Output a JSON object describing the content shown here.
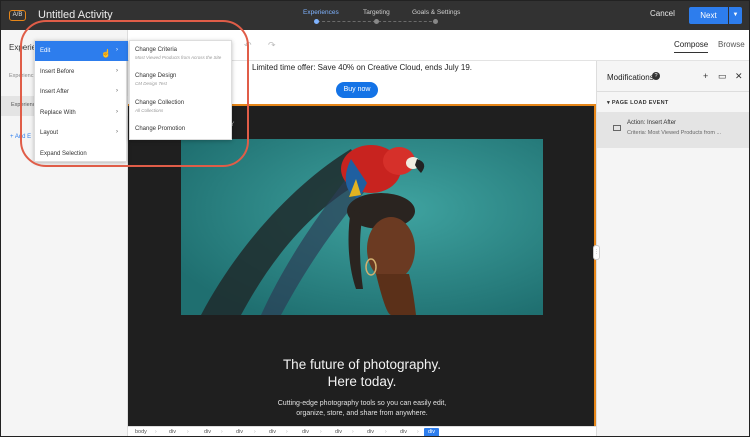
{
  "topbar": {
    "badge": "A/B",
    "title": "Untitled Activity",
    "steps": [
      "Experiences",
      "Targeting",
      "Goals & Settings"
    ],
    "cancel": "Cancel",
    "next": "Next",
    "next_dropdown_icon": "chevron-down-icon",
    "active_color": "#2d7ded",
    "accent_color": "#e68619"
  },
  "leftpanel": {
    "title": "Experie",
    "sub": "Experienc",
    "item": "Experienc",
    "add": "+ Add E"
  },
  "toolbar": {
    "undo_icon": "undo-icon",
    "redo_icon": "redo-icon",
    "tab_compose": "Compose",
    "tab_browse": "Browse"
  },
  "canvas": {
    "offer": "Limited time offer: Save 40% on Creative Cloud, ends July 19.",
    "buy": "Buy now",
    "section_tag": "Y",
    "headline_1": "The future of photography.",
    "headline_2": "Here today.",
    "sub_1": "Cutting-edge photography tools so you can easily edit,",
    "sub_2": "organize, store, and share from anywhere."
  },
  "breadcrumb": [
    "body",
    "div",
    "div",
    "div",
    "div",
    "div",
    "div",
    "div",
    "div",
    "div"
  ],
  "menu": {
    "items": [
      {
        "label": "Edit",
        "has_sub": true
      },
      {
        "label": "Insert Before",
        "has_sub": true
      },
      {
        "label": "Insert After",
        "has_sub": true
      },
      {
        "label": "Replace With",
        "has_sub": true
      },
      {
        "label": "Layout",
        "has_sub": true
      },
      {
        "label": "Expand Selection",
        "has_sub": false
      }
    ]
  },
  "submenu": {
    "items": [
      {
        "label": "Change Criteria",
        "note": "Most Viewed Products from Across the Site"
      },
      {
        "label": "Change Design",
        "note": "CM Design Test"
      },
      {
        "label": "Change Collection",
        "note": "All Collections"
      },
      {
        "label": "Change Promotion",
        "note": ""
      }
    ]
  },
  "rightpanel": {
    "title": "Modifications",
    "help": "?",
    "add": "+",
    "view": "▭",
    "close": "✕",
    "section": "PAGE LOAD EVENT",
    "card_line1": "Action: Insert After",
    "card_line2": "Criteria: Most Viewed Products from ..."
  }
}
